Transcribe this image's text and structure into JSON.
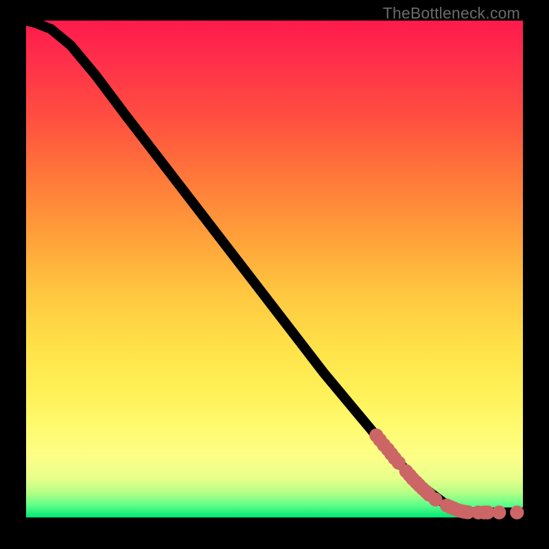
{
  "watermark": "TheBottleneck.com",
  "chart_data": {
    "type": "line",
    "title": "",
    "xlabel": "",
    "ylabel": "",
    "xlim": [
      0,
      100
    ],
    "ylim": [
      0,
      100
    ],
    "curve": [
      {
        "x": 0,
        "y": 100
      },
      {
        "x": 2,
        "y": 99.5
      },
      {
        "x": 5,
        "y": 98.3
      },
      {
        "x": 9,
        "y": 95
      },
      {
        "x": 14,
        "y": 89
      },
      {
        "x": 20,
        "y": 81
      },
      {
        "x": 30,
        "y": 68
      },
      {
        "x": 40,
        "y": 55
      },
      {
        "x": 50,
        "y": 42
      },
      {
        "x": 60,
        "y": 29
      },
      {
        "x": 70,
        "y": 17
      },
      {
        "x": 76,
        "y": 10
      },
      {
        "x": 80,
        "y": 6
      },
      {
        "x": 84,
        "y": 3
      },
      {
        "x": 87.5,
        "y": 1.5
      },
      {
        "x": 90,
        "y": 1
      },
      {
        "x": 93,
        "y": 1
      },
      {
        "x": 96,
        "y": 1
      },
      {
        "x": 100,
        "y": 1
      }
    ],
    "markers": [
      {
        "x": 70.5,
        "y": 16.5
      },
      {
        "x": 71.2,
        "y": 15.6
      },
      {
        "x": 72.0,
        "y": 14.6
      },
      {
        "x": 72.8,
        "y": 13.7
      },
      {
        "x": 73.5,
        "y": 12.8
      },
      {
        "x": 74.2,
        "y": 11.9
      },
      {
        "x": 75.0,
        "y": 11.0
      },
      {
        "x": 76.5,
        "y": 9.3
      },
      {
        "x": 77.2,
        "y": 8.5
      },
      {
        "x": 77.8,
        "y": 7.8
      },
      {
        "x": 78.5,
        "y": 7.1
      },
      {
        "x": 79.1,
        "y": 6.5
      },
      {
        "x": 79.8,
        "y": 5.8
      },
      {
        "x": 80.5,
        "y": 5.2
      },
      {
        "x": 81.1,
        "y": 4.6
      },
      {
        "x": 82.4,
        "y": 3.6
      },
      {
        "x": 84.7,
        "y": 2.4
      },
      {
        "x": 85.4,
        "y": 2.1
      },
      {
        "x": 86.1,
        "y": 1.8
      },
      {
        "x": 86.8,
        "y": 1.5
      },
      {
        "x": 87.5,
        "y": 1.3
      },
      {
        "x": 88.2,
        "y": 1.15
      },
      {
        "x": 88.9,
        "y": 1.05
      },
      {
        "x": 91.0,
        "y": 1.0
      },
      {
        "x": 92.2,
        "y": 1.0
      },
      {
        "x": 92.9,
        "y": 1.0
      },
      {
        "x": 95.2,
        "y": 1.0
      },
      {
        "x": 98.8,
        "y": 1.0
      }
    ]
  },
  "colors": {
    "curve": "#000000",
    "marker": "#cc6666",
    "background_frame": "#000000"
  }
}
